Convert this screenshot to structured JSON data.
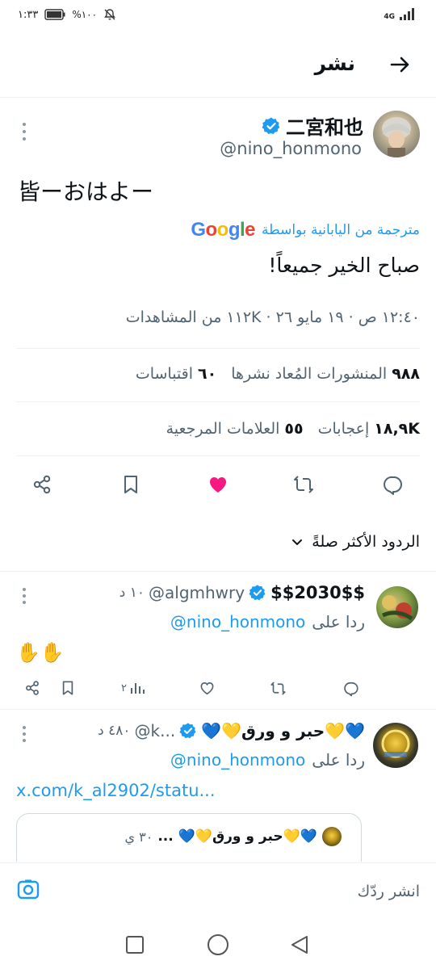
{
  "status": {
    "time": "١:٣٣",
    "battery": "%١٠٠",
    "network": "4G"
  },
  "header": {
    "title": "نشر"
  },
  "tweet": {
    "author_name": "二宮和也",
    "author_handle": "@nino_honmono",
    "text": "皆ーおはよー",
    "translated_by_prefix": "مترجمة من اليابانية بواسطة",
    "translated_by_brand": "Google",
    "translation": "صباح الخير جميعاً!",
    "meta": "١٢:٤٠ ص · ١٩ مايو ٢٦ · ١١٢K من المشاهدات",
    "stats_reposts_count": "٩٨٨",
    "stats_reposts_label": "المنشورات المُعاد نشرها",
    "stats_quotes_count": "٦٠",
    "stats_quotes_label": "اقتباسات",
    "stats_likes_count": "١٨,٩K",
    "stats_likes_label": "إعجابات",
    "stats_bookmarks_count": "٥٥",
    "stats_bookmarks_label": "العلامات المرجعية",
    "liked": true
  },
  "sort": {
    "label": "الردود الأكثر صلةً"
  },
  "replies": [
    {
      "author_name": "$$2030$$",
      "author_handle": "@algmhwry",
      "time": "١٠ د",
      "replying_to_prefix": "ردا على",
      "replying_to_handle": "@nino_honmono",
      "text": "✋✋",
      "views": "٢",
      "avatar_color": "#5a7a3a"
    },
    {
      "author_name": "💙💛حبر و ورق💛💙",
      "author_handle": "@k...",
      "time": "٤٨٠ د",
      "replying_to_prefix": "ردا على",
      "replying_to_handle": "@nino_honmono",
      "link": "x.com/k_al2902/statu...",
      "quoted_name": "💙💛حبر و ورق💛💙 ...",
      "quoted_time": "٣٠ ي",
      "avatar_color": "#2b2b1a"
    }
  ],
  "reply_bar": {
    "placeholder": "انشر ردّك"
  },
  "colors": {
    "accent": "#1d9bf0",
    "like": "#f91880",
    "text": "#0f1419",
    "secondary": "#536471"
  }
}
